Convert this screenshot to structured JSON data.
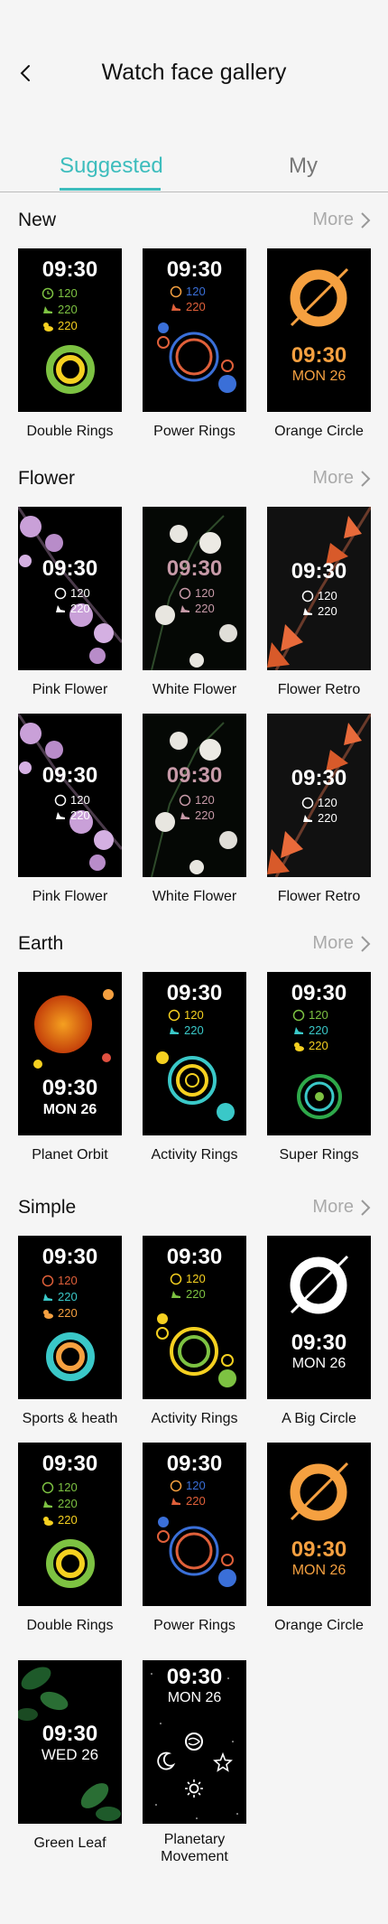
{
  "header": {
    "title": "Watch face gallery"
  },
  "tabs": [
    {
      "label": "Suggested"
    },
    {
      "label": "My"
    }
  ],
  "sections": {
    "new": {
      "title": "New",
      "more": "More",
      "items": [
        {
          "label": "Double Rings",
          "time": "09:30",
          "s1": "120",
          "s2": "220",
          "s3": "220"
        },
        {
          "label": "Power Rings",
          "time": "09:30",
          "s1": "120",
          "s2": "220"
        },
        {
          "label": "Orange Circle",
          "time": "09:30",
          "date": "MON 26"
        }
      ]
    },
    "flower": {
      "title": "Flower",
      "more": "More",
      "items": [
        {
          "label": "Pink Flower",
          "time": "09:30",
          "s1": "120",
          "s2": "220"
        },
        {
          "label": "White Flower",
          "time": "09:30",
          "s1": "120",
          "s2": "220"
        },
        {
          "label": "Flower Retro",
          "time": "09:30",
          "s1": "120",
          "s2": "220"
        },
        {
          "label": "Pink Flower",
          "time": "09:30",
          "s1": "120",
          "s2": "220"
        },
        {
          "label": "White Flower",
          "time": "09:30",
          "s1": "120",
          "s2": "220"
        },
        {
          "label": "Flower Retro",
          "time": "09:30",
          "s1": "120",
          "s2": "220"
        }
      ]
    },
    "earth": {
      "title": "Earth",
      "more": "More",
      "items": [
        {
          "label": "Planet Orbit",
          "time": "09:30",
          "date": "MON 26"
        },
        {
          "label": "Activity Rings",
          "time": "09:30",
          "s1": "120",
          "s2": "220"
        },
        {
          "label": "Super Rings",
          "time": "09:30",
          "s1": "120",
          "s2": "220",
          "s3": "220"
        }
      ]
    },
    "simple": {
      "title": "Simple",
      "more": "More",
      "items": [
        {
          "label": "Sports & heath",
          "time": "09:30",
          "s1": "120",
          "s2": "220",
          "s3": "220"
        },
        {
          "label": "Activity Rings",
          "time": "09:30",
          "s1": "120",
          "s2": "220"
        },
        {
          "label": "A Big Circle",
          "time": "09:30",
          "date": "MON 26"
        },
        {
          "label": "Double Rings",
          "time": "09:30",
          "s1": "120",
          "s2": "220",
          "s3": "220"
        },
        {
          "label": "Power Rings",
          "time": "09:30",
          "s1": "120",
          "s2": "220"
        },
        {
          "label": "Orange Circle",
          "time": "09:30",
          "date": "MON 26"
        },
        {
          "label": "Green Leaf",
          "time": "09:30",
          "date": "WED 26"
        },
        {
          "label": "Planetary\nMovement",
          "time": "09:30",
          "date": "MON 26"
        }
      ]
    }
  },
  "colors": {
    "accent": "#3dbdbd",
    "orange": "#f5a040",
    "green": "#7dc242",
    "yellow": "#f5d020",
    "blue": "#3a6fd8",
    "teal": "#3ac8c8"
  }
}
